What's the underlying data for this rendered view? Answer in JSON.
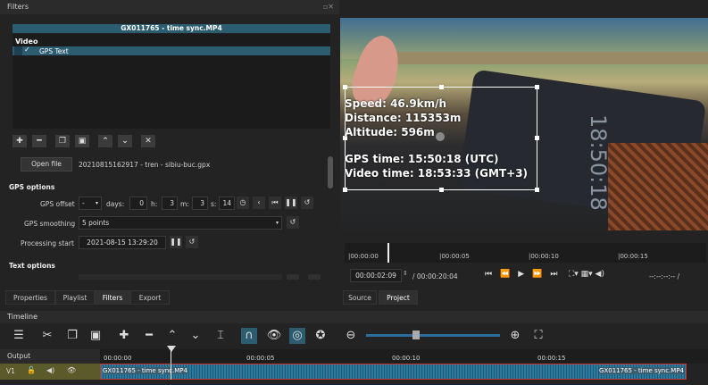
{
  "filters": {
    "title": "Filters",
    "clip_name": "GX011765 - time sync.MP4",
    "group_label": "Video",
    "filter_item": {
      "check": "✓",
      "label": "GPS Text"
    },
    "open_file_label": "Open file",
    "file_name": "20210815162917 - tren - sibiu-buc.gpx",
    "gps_options_heading": "GPS options",
    "gps_offset_label": "GPS offset",
    "offset_sign": "-",
    "days_label": "days:",
    "days_value": "0",
    "h_label": "h:",
    "h_value": "3",
    "m_label": "m:",
    "m_value": "3",
    "s_label": "s:",
    "s_value": "14",
    "gps_smoothing_label": "GPS smoothing",
    "gps_smoothing_value": "5 points",
    "processing_start_label": "Processing start",
    "processing_start_value": "2021-08-15 13:29:20",
    "text_options_heading": "Text options",
    "tabs": [
      "Properties",
      "Playlist",
      "Filters",
      "Export"
    ]
  },
  "player": {
    "overlay_lines": [
      "Speed: 46.9km/h",
      "Distance: 115353m",
      "Altitude: 596m",
      "GPS time: 15:50:18 (UTC)",
      "Video time: 18:53:33 (GMT+3)"
    ],
    "phone_clock": "18:50:18",
    "ruler_labels": [
      "|00:00:00",
      "|00:00:05",
      "|00:00:10",
      "|00:00:15"
    ],
    "current_time": "00:00:02:09",
    "total_time": "/ 00:00:20:04",
    "in_out": "--:--:--:-- /",
    "tabs": [
      "Source",
      "Project"
    ]
  },
  "timeline": {
    "title": "Timeline",
    "output_label": "Output",
    "track_name": "V1",
    "ruler_labels": [
      "00:00:00",
      "00:00:05",
      "00:00:10",
      "00:00:15"
    ],
    "clip_label_left": "GX011765 - time sync.MP4",
    "clip_label_right": "GX011765 - time sync.MP4"
  }
}
